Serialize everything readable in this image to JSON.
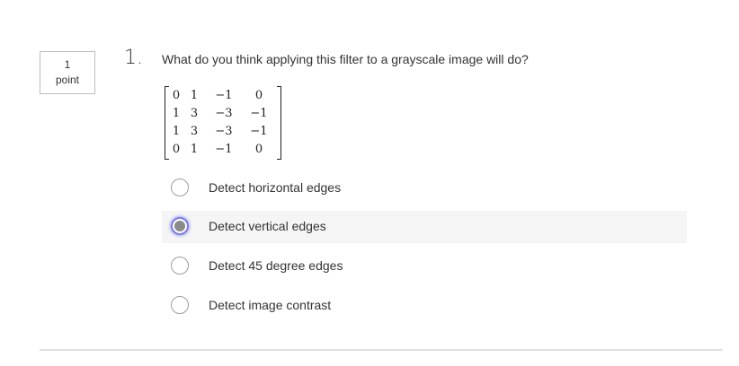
{
  "points": {
    "value": "1",
    "unit": "point"
  },
  "question": {
    "number": "1.",
    "text": "What do you think applying this filter to a grayscale image will do?",
    "matrix": [
      [
        "0",
        "1",
        "−1",
        "0"
      ],
      [
        "1",
        "3",
        "−3",
        "−1"
      ],
      [
        "1",
        "3",
        "−3",
        "−1"
      ],
      [
        "0",
        "1",
        "−1",
        "0"
      ]
    ]
  },
  "options": [
    {
      "label": "Detect horizontal edges",
      "selected": false
    },
    {
      "label": "Detect vertical edges",
      "selected": true
    },
    {
      "label": "Detect 45 degree edges",
      "selected": false
    },
    {
      "label": "Detect image contrast",
      "selected": false
    }
  ],
  "colors": {
    "selected_ring": "#7b7fe6",
    "selected_dot": "#8a8a8a",
    "selected_row_bg": "#f5f5f5"
  }
}
